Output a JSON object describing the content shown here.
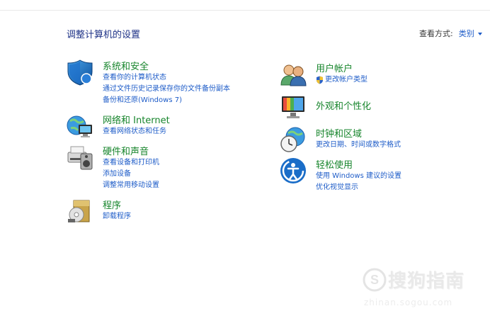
{
  "header": {
    "title": "调整计算机的设置",
    "view_by_label": "查看方式:",
    "view_by_value": "类别"
  },
  "categories": [
    {
      "title": "系统和安全",
      "icon": "security-shield-icon",
      "links": [
        "查看你的计算机状态",
        "通过文件历史记录保存你的文件备份副本",
        "备份和还原(Windows 7)"
      ]
    },
    {
      "title": "网络和 Internet",
      "icon": "network-icon",
      "links": [
        "查看网络状态和任务"
      ]
    },
    {
      "title": "硬件和声音",
      "icon": "hardware-sound-icon",
      "links": [
        "查看设备和打印机",
        "添加设备",
        "调整常用移动设置"
      ]
    },
    {
      "title": "程序",
      "icon": "programs-icon",
      "links": [
        "卸载程序"
      ]
    },
    {
      "title": "用户帐户",
      "icon": "user-accounts-icon",
      "links": [
        "更改帐户类型"
      ]
    },
    {
      "title": "外观和个性化",
      "icon": "appearance-icon",
      "links": []
    },
    {
      "title": "时钟和区域",
      "icon": "clock-region-icon",
      "links": [
        "更改日期、时间或数字格式"
      ]
    },
    {
      "title": "轻松使用",
      "icon": "ease-of-access-icon",
      "links": [
        "使用 Windows 建议的设置",
        "优化视觉显示"
      ]
    }
  ],
  "watermark": {
    "title": "搜狗指南",
    "url": "zhinan.sogou.com"
  },
  "colors": {
    "category_title": "#17852c",
    "link": "#1e5cc8",
    "page_title": "#1e3287"
  }
}
